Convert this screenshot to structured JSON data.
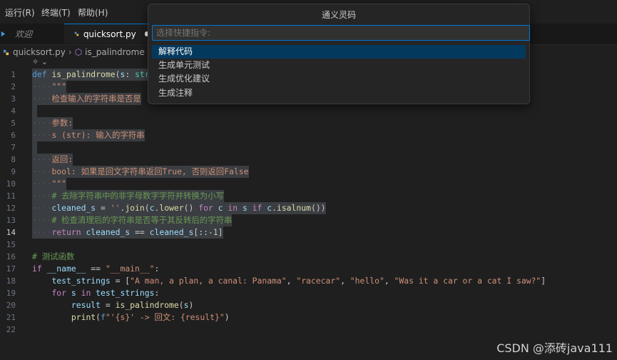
{
  "menu": [
    {
      "label": "运行(R)"
    },
    {
      "label": "终端(T)"
    },
    {
      "label": "帮助(H)"
    }
  ],
  "tabs": [
    {
      "label": "欢迎"
    },
    {
      "label": "quicksort.py"
    }
  ],
  "breadcrumb": {
    "file": "quicksort.py",
    "symbol": "is_palindrome"
  },
  "palette": {
    "title": "通义灵码",
    "placeholder": "选择快捷指令:",
    "items": [
      {
        "label": "解释代码"
      },
      {
        "label": "生成单元测试"
      },
      {
        "label": "生成优化建议"
      },
      {
        "label": "生成注释"
      }
    ]
  },
  "line_numbers": [
    "1",
    "2",
    "3",
    "4",
    "5",
    "6",
    "7",
    "8",
    "9",
    "10",
    "11",
    "12",
    "13",
    "14",
    "15",
    "16",
    "17",
    "18",
    "19",
    "20",
    "21",
    "22"
  ],
  "code_text": {
    "l3": "检查输入的字符串是否是",
    "l5": "参数:",
    "l6": "s (str): 输入的字符串",
    "l8": "返回:",
    "l9": "bool: 如果是回文字符串返回True, 否则返回False",
    "l11": "# 去除字符串中的非字母数字字符并转换为小写",
    "l13": "# 检查清理后的字符串是否等于其反转后的字符串",
    "l16": "# 测试函数",
    "l18_str1": "\"A man, a plan, a canal: Panama\"",
    "l18_str2": "\"racecar\"",
    "l18_str3": "\"hello\"",
    "l18_str4": "\"Was it a car or a cat I saw?\"",
    "l21_str": "'{s}' -> 回文: {result}"
  },
  "watermark": "CSDN @添砖java111",
  "colors": {
    "accent": "#0078d4",
    "keyword": "#569cd6",
    "string": "#ce9178",
    "comment": "#6a9955",
    "function": "#dcdcaa",
    "variable": "#9cdcfe"
  }
}
